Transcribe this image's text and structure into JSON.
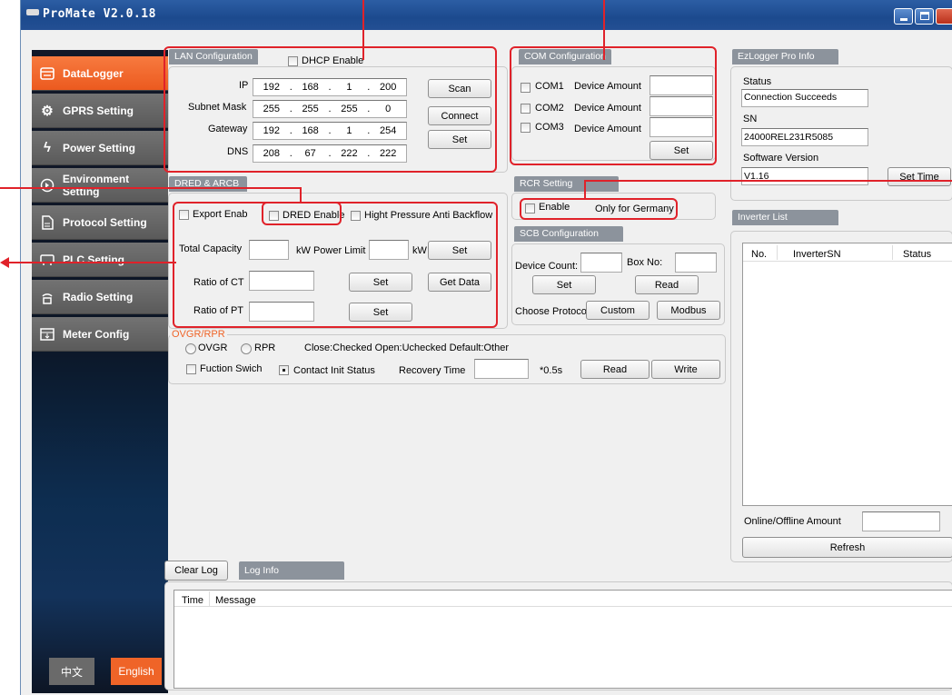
{
  "window": {
    "title": "ProMate V2.0.18"
  },
  "sidebar": {
    "items": [
      {
        "label": "DataLogger",
        "icon": "datalogger-icon"
      },
      {
        "label": "GPRS Setting",
        "icon": "gear-icon"
      },
      {
        "label": "Power Setting",
        "icon": "power-icon"
      },
      {
        "label": "Environment Setting",
        "icon": "environment-icon"
      },
      {
        "label": "Protocol Setting",
        "icon": "document-icon"
      },
      {
        "label": "PLC Setting",
        "icon": "plc-icon"
      },
      {
        "label": "Radio Setting",
        "icon": "radio-icon"
      },
      {
        "label": "Meter Config",
        "icon": "meter-icon"
      }
    ],
    "lang_zh": "中文",
    "lang_en": "English",
    "accent": "#ef6428"
  },
  "lan": {
    "tab": "LAN Configuration",
    "dhcp_label": "DHCP Enable",
    "ip_label": "IP",
    "ip": [
      "192",
      "168",
      "1",
      "200"
    ],
    "subnet_label": "Subnet Mask",
    "subnet": [
      "255",
      "255",
      "255",
      "0"
    ],
    "gateway_label": "Gateway",
    "gateway": [
      "192",
      "168",
      "1",
      "254"
    ],
    "dns_label": "DNS",
    "dns": [
      "208",
      "67",
      "222",
      "222"
    ],
    "scan": "Scan",
    "connect": "Connect",
    "set": "Set"
  },
  "com": {
    "tab": "COM Configuration",
    "rows": [
      {
        "name": "COM1",
        "label": "Device Amount"
      },
      {
        "name": "COM2",
        "label": "Device Amount"
      },
      {
        "name": "COM3",
        "label": "Device Amount"
      }
    ],
    "set": "Set"
  },
  "ezlogger": {
    "tab": "EzLogger Pro Info",
    "status_label": "Status",
    "status_value": "Connection Succeeds",
    "sn_label": "SN",
    "sn_value": "24000REL231R5085",
    "sw_label": "Software Version",
    "sw_value": "V1.16",
    "set_time": "Set Time"
  },
  "dred": {
    "tab": "DRED & ARCB",
    "export": "Export Enab",
    "dred_enable": "DRED Enable",
    "high_pressure": "Hight Pressure Anti Backflow",
    "total_capacity": "Total Capacity",
    "kw_power_limit": "kW Power Limit",
    "kw": "kW",
    "set": "Set",
    "ratio_ct": "Ratio of CT",
    "ratio_pt": "Ratio of PT",
    "get_data": "Get Data"
  },
  "rcr": {
    "tab": "RCR Setting",
    "enable": "Enable",
    "note": "Only for Germany"
  },
  "scb": {
    "tab": "SCB Configuration",
    "device_count": "Device Count:",
    "box_no": "Box No:",
    "set": "Set",
    "read": "Read",
    "choose_protocol": "Choose Protoco",
    "custom": "Custom",
    "modbus": "Modbus"
  },
  "ovgr": {
    "title": "OVGR/RPR",
    "ovgr": "OVGR",
    "rpr": "RPR",
    "hint": "Close:Checked Open:Uchecked Default:Other",
    "function_switch": "Fuction Swich",
    "contact_init": "Contact Init Status",
    "recovery_time": "Recovery Time",
    "unit": "*0.5s",
    "read": "Read",
    "write": "Write"
  },
  "inverter": {
    "tab": "Inverter List",
    "columns": [
      "No.",
      "InverterSN",
      "Status"
    ],
    "online_label": "Online/Offline Amount",
    "refresh": "Refresh"
  },
  "log": {
    "clear": "Clear Log",
    "tab": "Log Info",
    "columns": [
      "Time",
      "Message"
    ]
  },
  "colors": {
    "annotation": "#e0222a",
    "titlebar": "#1c4a8e",
    "tab": "#8c939c"
  }
}
